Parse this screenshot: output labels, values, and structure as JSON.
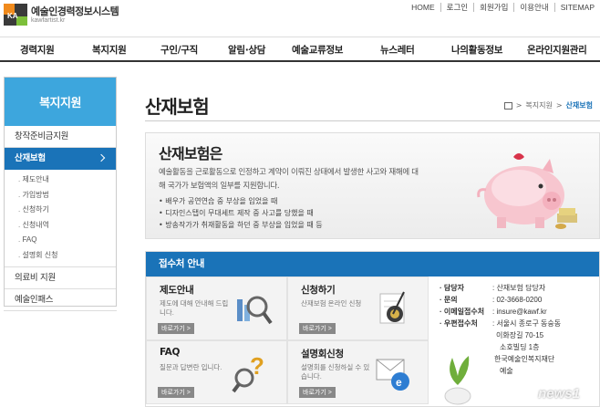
{
  "header": {
    "logo_mark": "KA",
    "logo_title": "예술인경력정보시스템",
    "logo_sub": "kawfartist.kr",
    "util_links": [
      "HOME",
      "로그인",
      "회원가입",
      "이용안내",
      "SITEMAP"
    ]
  },
  "gnb": [
    "경력지원",
    "복지지원",
    "구인/구직",
    "알림·상담",
    "예술교류정보",
    "뉴스레터",
    "나의활동정보",
    "온라인지원관리"
  ],
  "sidebar": {
    "title": "복지지원",
    "items": [
      {
        "label": "창작준비금지원"
      },
      {
        "label": "산재보험",
        "active": true,
        "subs": [
          "제도안내",
          "가입방법",
          "신청하기",
          "신청내역",
          "FAQ",
          "설명회 신청"
        ]
      },
      {
        "label": "의료비 지원"
      },
      {
        "label": "예술인패스"
      }
    ]
  },
  "page": {
    "title": "산재보험",
    "breadcrumb": [
      "복지지원",
      "산재보험"
    ]
  },
  "intro": {
    "heading": "산재보험은",
    "desc": "예술활동을 근로활동으로 인정하고 계약이 이뤄진 상태에서 발생한 사고와 재해에 대해 국가가 보험액의 일부를 지원합니다.",
    "bullets": [
      "배우가 공연연습 중 부상을 입었을 때",
      "디자인스탭이 무대세트 제작 중 사고를 당했을 때",
      "방송작가가 취재활동을 하던 중 부상을 입었을 때 등"
    ]
  },
  "guide": {
    "heading": "접수처 안내",
    "cards": [
      {
        "title": "제도안내",
        "desc": "제도에 대해 안내해 드립니다.",
        "more": "바로가기 >",
        "icon": "chart-magnifier-icon"
      },
      {
        "title": "신청하기",
        "desc": "산재보험 온라인 신청",
        "more": "바로가기 >",
        "icon": "form-pen-icon"
      },
      {
        "title": "FAQ",
        "desc": "질문과 답변란 입니다.",
        "more": "바로가기 >",
        "icon": "question-magnifier-icon"
      },
      {
        "title": "설명회신청",
        "desc": "설명회를 신청하실 수 있습니다.",
        "more": "바로가기 >",
        "icon": "globe-mail-icon"
      }
    ],
    "contact": [
      {
        "k": "담당자",
        "v": ": 산재보험 담당자"
      },
      {
        "k": "문의",
        "v": ": 02-3668-0200"
      },
      {
        "k": "이메일접수처",
        "v": ": insure@kawf.kr"
      },
      {
        "k": "우편접수처",
        "v": ": 서울시 종로구 동숭동"
      },
      {
        "k": "",
        "v": "이화장길 70-15"
      },
      {
        "k": "",
        "v": "소호빌딩 1층"
      },
      {
        "k": "",
        "v": "한국예술인복지재단"
      },
      {
        "k": "",
        "v": "예술"
      }
    ]
  },
  "watermark": "news1"
}
